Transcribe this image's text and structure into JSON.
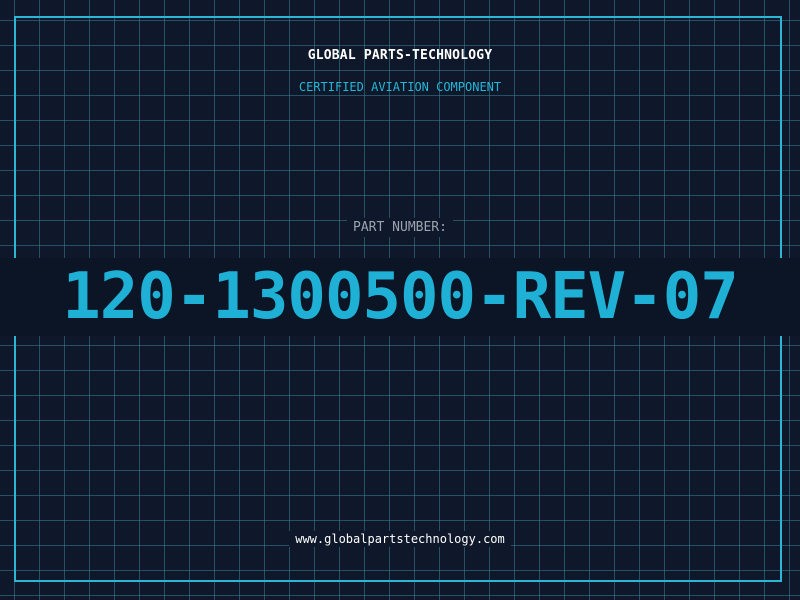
{
  "header": {
    "company": "GLOBAL PARTS-TECHNOLOGY",
    "subtitle": "CERTIFIED AVIATION COMPONENT"
  },
  "part": {
    "label": "PART NUMBER:",
    "value": "120-1300500-REV-07"
  },
  "footer": {
    "url": "www.globalpartstechnology.com"
  },
  "colors": {
    "background": "#0f172a",
    "grid": "#38828f",
    "accent": "#1fb0d6",
    "label": "#9ca3af",
    "text": "#ffffff"
  }
}
